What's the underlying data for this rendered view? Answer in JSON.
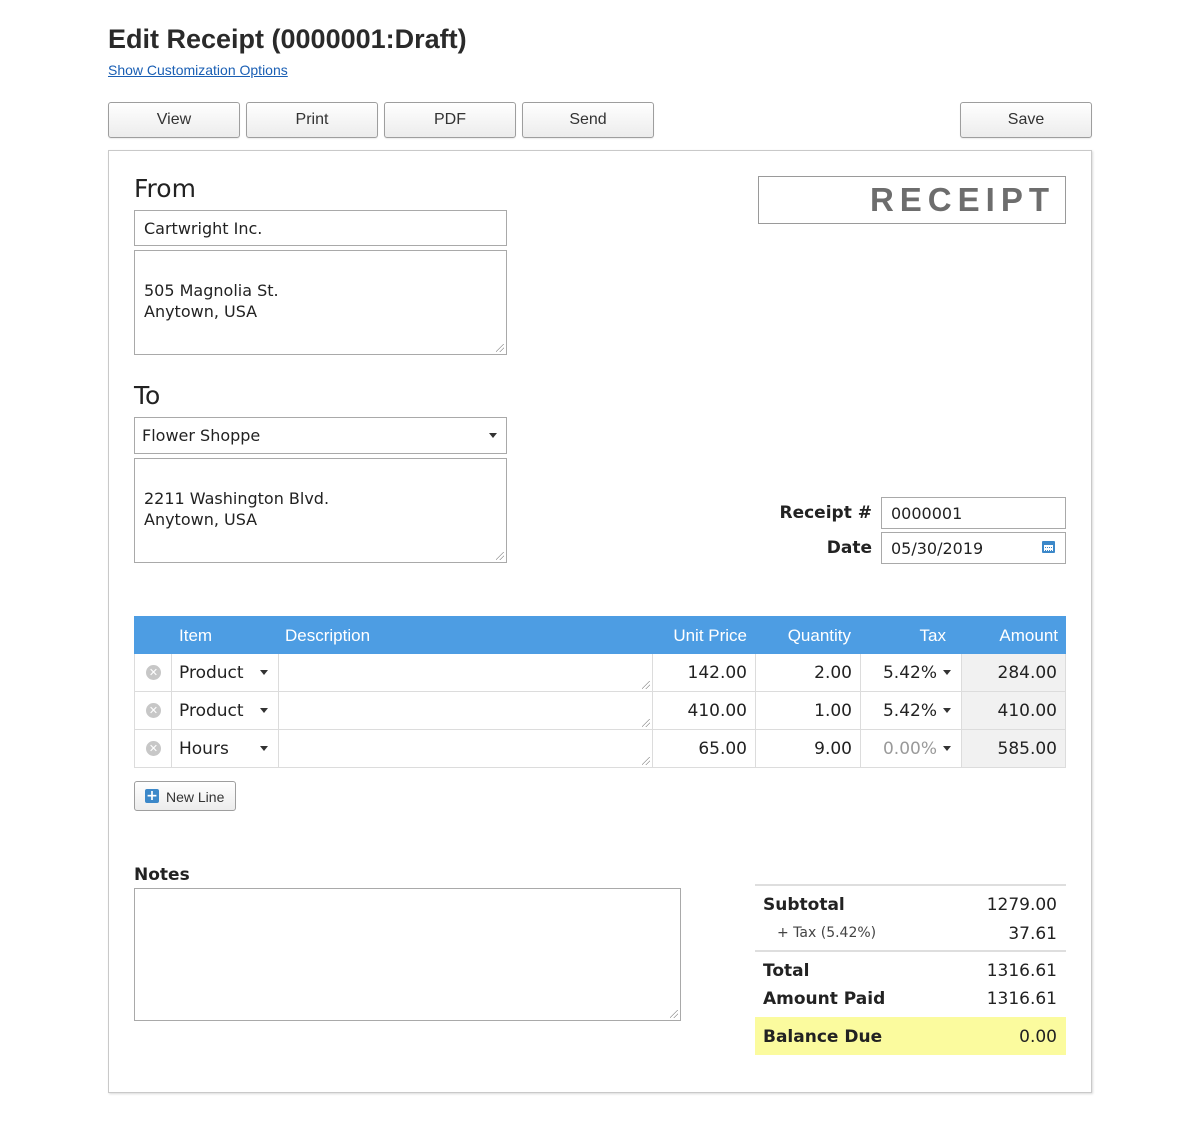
{
  "header": {
    "title": "Edit Receipt (0000001:Draft)",
    "customize_link": "Show Customization Options"
  },
  "toolbar": {
    "view_label": "View",
    "print_label": "Print",
    "pdf_label": "PDF",
    "send_label": "Send",
    "save_label": "Save"
  },
  "document": {
    "type_label": "RECEIPT",
    "from": {
      "label": "From",
      "name": "Cartwright Inc.",
      "address": "505 Magnolia St.\nAnytown, USA"
    },
    "to": {
      "label": "To",
      "name": "Flower Shoppe",
      "address": "2211 Washington Blvd.\nAnytown, USA"
    },
    "meta": {
      "receipt_label": "Receipt #",
      "receipt_number": "0000001",
      "date_label": "Date",
      "date": "05/30/2019"
    }
  },
  "items_table": {
    "headers": {
      "item": "Item",
      "description": "Description",
      "unit_price": "Unit Price",
      "quantity": "Quantity",
      "tax": "Tax",
      "amount": "Amount"
    },
    "rows": [
      {
        "item": "Product",
        "description": "",
        "unit_price": "142.00",
        "quantity": "2.00",
        "tax": "5.42%",
        "amount": "284.00"
      },
      {
        "item": "Product",
        "description": "",
        "unit_price": "410.00",
        "quantity": "1.00",
        "tax": "5.42%",
        "amount": "410.00"
      },
      {
        "item": "Hours",
        "description": "",
        "unit_price": "65.00",
        "quantity": "9.00",
        "tax": "0.00%",
        "amount": "585.00"
      }
    ],
    "new_line_label": "New Line"
  },
  "notes": {
    "label": "Notes",
    "value": ""
  },
  "totals": {
    "subtotal_label": "Subtotal",
    "subtotal": "1279.00",
    "tax_label": "+ Tax (5.42%)",
    "tax": "37.61",
    "total_label": "Total",
    "total": "1316.61",
    "paid_label": "Amount Paid",
    "paid": "1316.61",
    "balance_label": "Balance Due",
    "balance": "0.00"
  },
  "colors": {
    "accent": "#4d9de3",
    "balance_highlight": "#fbfb9e",
    "link": "#1a5fb4",
    "zero_tax_text": "#9a9a9a"
  },
  "icons": [
    "remove-icon",
    "dropdown-caret-icon",
    "calendar-icon",
    "plus-icon",
    "resize-grip-icon"
  ]
}
